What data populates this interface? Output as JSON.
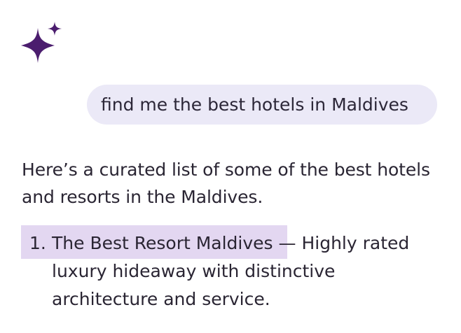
{
  "assistant": {
    "logo_icon": "sparkle-icon",
    "accent_color": "#4b1d6e"
  },
  "user_message": {
    "text": "find me the best hotels in Maldives"
  },
  "response": {
    "intro": "Here’s a curated list of some of the best hotels and resorts in the Maldives.",
    "items": [
      {
        "number": "1.",
        "name": "The Best Resort Maldives",
        "description": " — Highly rated luxury hideaway with distinctive architecture and service."
      }
    ]
  }
}
